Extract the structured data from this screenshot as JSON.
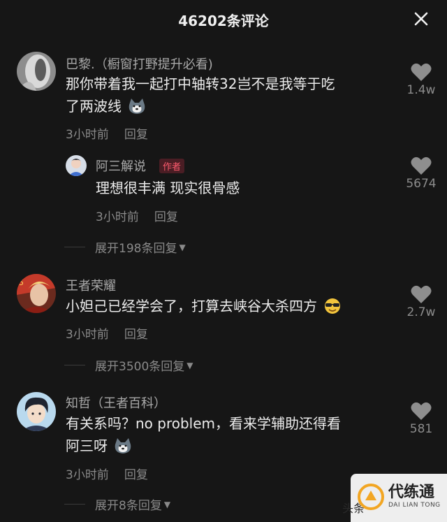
{
  "header": {
    "title": "46202条评论"
  },
  "comments": [
    {
      "user": "巴黎.（橱窗打野提升必看)",
      "text_line1": "那你带着我一起打中轴转32岂不是我等于吃",
      "text_line2": "了两波线",
      "time": "3小时前",
      "reply": "回复",
      "likes": "1.4w",
      "replies": [
        {
          "user": "阿三解说",
          "badge": "作者",
          "text": "理想很丰满 现实很骨感",
          "time": "3小时前",
          "reply": "回复",
          "likes": "5674"
        }
      ],
      "expand": "展开198条回复"
    },
    {
      "user": "王者荣耀",
      "text": "小妲己已经学会了，打算去峡谷大杀四方",
      "time": "3小时前",
      "reply": "回复",
      "likes": "2.7w",
      "expand": "展开3500条回复"
    },
    {
      "user": "知哲（王者百科）",
      "text_line1": "有关系吗？no problem，看来学辅助还得看",
      "text_line2": "阿三呀",
      "time": "3小时前",
      "reply": "回复",
      "likes": "581",
      "expand": "展开8条回复"
    }
  ],
  "watermark": {
    "head": "头条",
    "title": "代练通",
    "sub": "DAI LIAN TONG"
  },
  "icons": {
    "close": "close-icon",
    "like": "heart-icon",
    "expand": "caret-down-icon"
  }
}
